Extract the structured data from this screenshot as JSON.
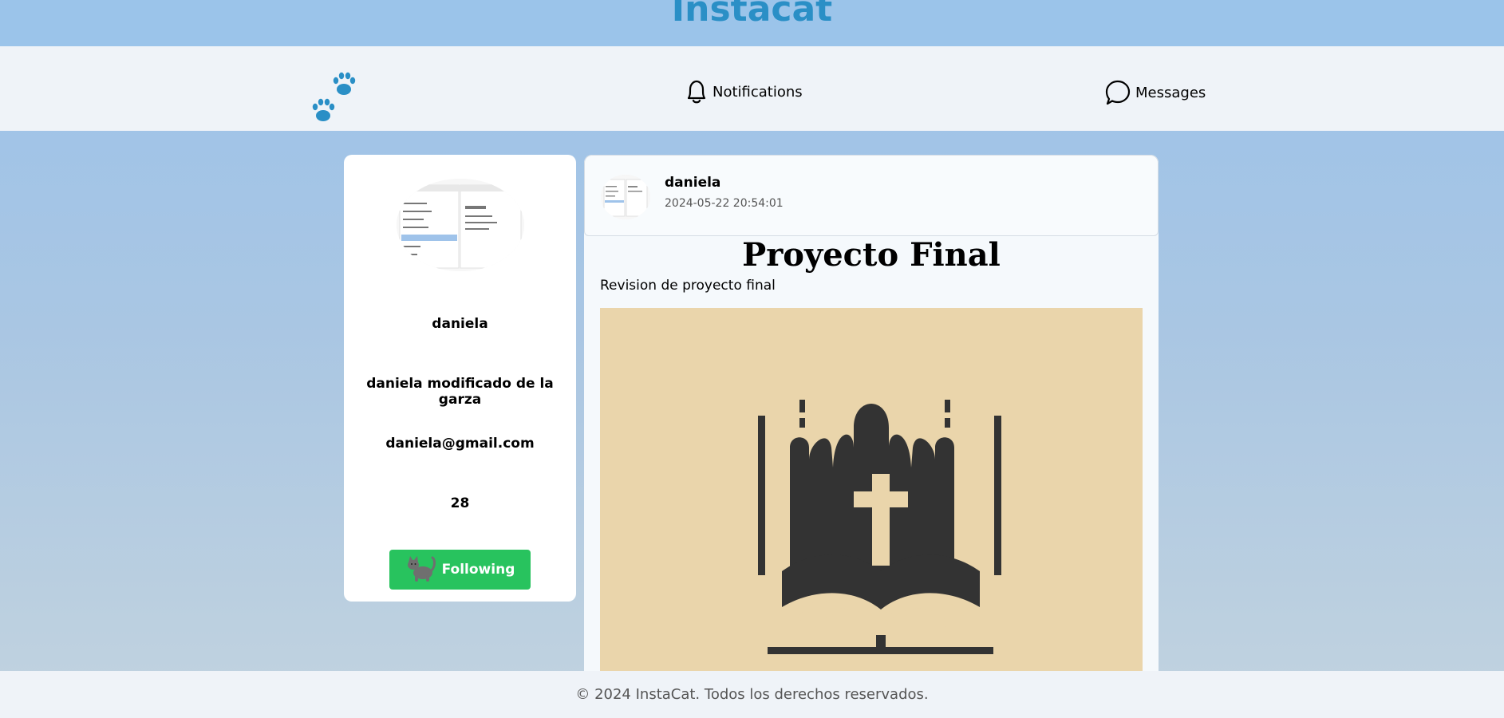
{
  "header": {
    "brand": "Instacat"
  },
  "nav": {
    "notifications_label": "Notifications",
    "messages_label": "Messages"
  },
  "profile": {
    "username": "daniela",
    "full_name": "daniela modificado de la garza",
    "email": "daniela@gmail.com",
    "age": "28",
    "follow_label": "Following"
  },
  "post": {
    "username": "daniela",
    "timestamp": "2024-05-22 20:54:01",
    "title": "Proyecto Final",
    "description": "Revision de proyecto final"
  },
  "footer": {
    "text": "© 2024 InstaCat. Todos los derechos reservados."
  },
  "colors": {
    "accent": "#2a8fc6",
    "follow_button": "#28c35e",
    "post_image_bg": "#ead5ab",
    "icon_dark": "#3a3a3a"
  }
}
